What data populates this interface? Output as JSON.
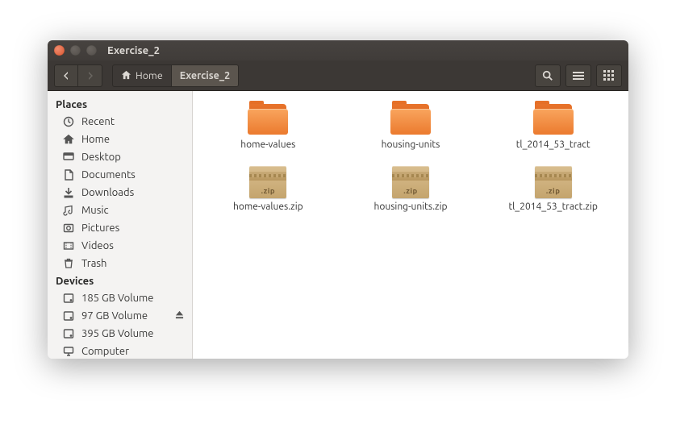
{
  "window": {
    "title": "Exercise_2"
  },
  "toolbar": {
    "breadcrumbs": [
      {
        "label": "Home",
        "icon": "home-icon",
        "active": false
      },
      {
        "label": "Exercise_2",
        "icon": null,
        "active": true
      }
    ]
  },
  "sidebar": {
    "sections": [
      {
        "heading": "Places",
        "items": [
          {
            "label": "Recent",
            "icon": "clock-icon",
            "eject": false
          },
          {
            "label": "Home",
            "icon": "home-icon",
            "eject": false
          },
          {
            "label": "Desktop",
            "icon": "desktop-icon",
            "eject": false
          },
          {
            "label": "Documents",
            "icon": "documents-icon",
            "eject": false
          },
          {
            "label": "Downloads",
            "icon": "downloads-icon",
            "eject": false
          },
          {
            "label": "Music",
            "icon": "music-icon",
            "eject": false
          },
          {
            "label": "Pictures",
            "icon": "pictures-icon",
            "eject": false
          },
          {
            "label": "Videos",
            "icon": "videos-icon",
            "eject": false
          },
          {
            "label": "Trash",
            "icon": "trash-icon",
            "eject": false
          }
        ]
      },
      {
        "heading": "Devices",
        "items": [
          {
            "label": "185 GB Volume",
            "icon": "drive-icon",
            "eject": false
          },
          {
            "label": "97 GB Volume",
            "icon": "drive-icon",
            "eject": true
          },
          {
            "label": "395 GB Volume",
            "icon": "drive-icon",
            "eject": false
          },
          {
            "label": "Computer",
            "icon": "computer-icon",
            "eject": false
          }
        ]
      }
    ]
  },
  "files": [
    {
      "name": "home-values",
      "type": "folder"
    },
    {
      "name": "housing-units",
      "type": "folder"
    },
    {
      "name": "tl_2014_53_tract",
      "type": "folder"
    },
    {
      "name": "home-values.zip",
      "type": "zip"
    },
    {
      "name": "housing-units.zip",
      "type": "zip"
    },
    {
      "name": "tl_2014_53_tract.zip",
      "type": "zip"
    }
  ],
  "zip_glyph": ".zip"
}
